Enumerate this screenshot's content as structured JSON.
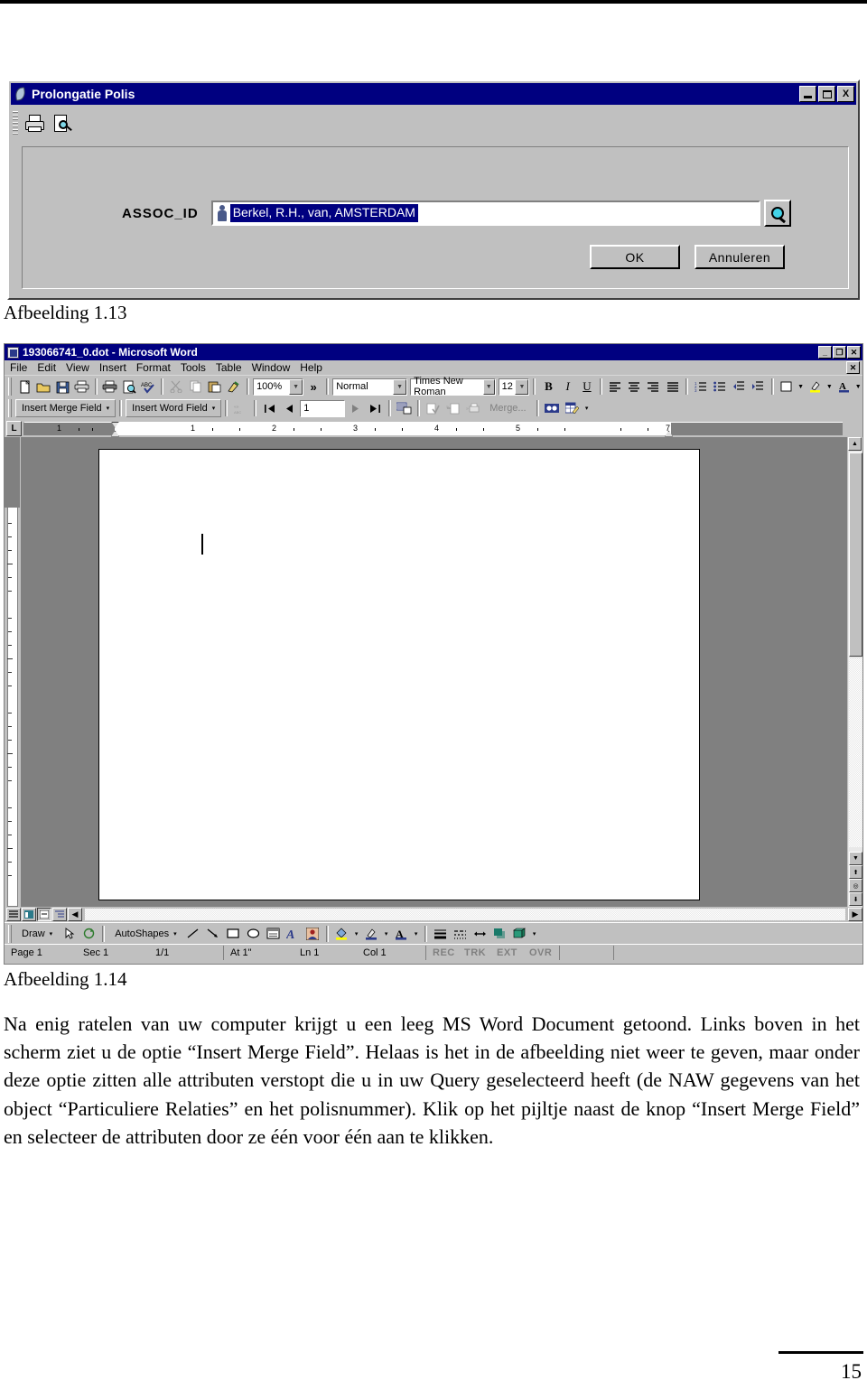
{
  "document": {
    "page_number": "15",
    "caption_113": "Afbeelding 1.13",
    "caption_114": "Afbeelding 1.14",
    "paragraph": "Na enig ratelen van uw computer krijgt u een leeg MS Word Document getoond. Links boven in het scherm ziet u de optie “Insert Merge Field”. Helaas is het in de afbeelding niet weer te geven, maar onder deze optie zitten alle attributen verstopt die u in uw Query geselecteerd heeft (de NAW gegevens van het object “Particuliere Relaties” en het polisnummer). Klik op het pijltje naast de knop “Insert Merge Field” en selecteer de attributen door ze één voor één aan te klikken."
  },
  "dialog": {
    "title": "Prolongatie Polis",
    "title_icon": "leaf-icon",
    "window_buttons": {
      "minimize": "_",
      "maximize": "□",
      "close": "X"
    },
    "toolbar": [
      {
        "name": "print-icon",
        "label": "Print"
      },
      {
        "name": "print-preview-icon",
        "label": "Print Preview"
      }
    ],
    "field": {
      "label": "ASSOC_ID",
      "value": "Berkel, R.H., van, AMSTERDAM",
      "placeholder": "",
      "record_icon": "person-icon",
      "find_button_icon": "magnifier-icon"
    },
    "buttons": {
      "ok": "OK",
      "cancel": "Annuleren"
    }
  },
  "word": {
    "title": "193066741_0.dot - Microsoft Word",
    "title_icon": "word-document-icon",
    "window_buttons": {
      "minimize": "_",
      "restore": "❐",
      "close": "✕"
    },
    "document_close": "✕",
    "menu": [
      "File",
      "Edit",
      "View",
      "Insert",
      "Format",
      "Tools",
      "Table",
      "Window",
      "Help"
    ],
    "standard_toolbar": {
      "icons": [
        "new-document-icon",
        "open-folder-icon",
        "save-icon",
        "print-icon",
        "print2-icon",
        "print-preview-icon",
        "spelling-check-icon",
        "cut-scissors-icon",
        "copy-icon",
        "paste-icon",
        "format-painter-icon"
      ],
      "zoom_value": "100%",
      "overflow_label": "»"
    },
    "formatting_toolbar": {
      "style_value": "Normal",
      "font_value": "Times New Roman",
      "size_value": "12",
      "bold": "B",
      "italic": "I",
      "underline": "U",
      "icons": [
        "align-left-icon",
        "align-center-icon",
        "align-right-icon",
        "align-justify-icon",
        "numbered-list-icon",
        "bulleted-list-icon",
        "decrease-indent-icon",
        "increase-indent-icon",
        "borders-icon",
        "highlight-icon",
        "font-color-icon"
      ]
    },
    "mailmerge_toolbar": {
      "insert_merge_field": "Insert Merge Field",
      "insert_word_field": "Insert Word Field",
      "view_merged_data_icon": "view-merged-data-icon",
      "nav_first": "⏮",
      "nav_prev": "◀",
      "record_number": "1",
      "nav_next": "▶",
      "nav_last": "⏭",
      "mail_merge_helper_icon": "mail-merge-helper-icon",
      "check_errors_icon": "check-errors-icon",
      "merge_to_new_doc_icon": "merge-to-new-document-icon",
      "merge_to_printer_icon": "merge-to-printer-icon",
      "merge_label": "Merge...",
      "find_record_icon": "find-record-icon",
      "edit_data_source_icon": "edit-data-source-icon",
      "dropdown": "▾"
    },
    "ruler": {
      "tab_selector": "L",
      "numbers": [
        "1",
        "1",
        "2",
        "3",
        "4",
        "5",
        "7"
      ]
    },
    "drawing_toolbar": {
      "draw_label": "Draw",
      "autoshapes_label": "AutoShapes",
      "icons": [
        "select-arrow-icon",
        "free-rotate-icon",
        "line-icon",
        "arrow-icon",
        "rectangle-icon",
        "oval-icon",
        "text-box-icon",
        "wordart-icon",
        "clip-art-icon",
        "fill-color-icon",
        "line-color-icon",
        "font-color-icon",
        "line-style-icon",
        "dash-style-icon",
        "arrow-style-icon",
        "shadow-icon",
        "3d-icon"
      ]
    },
    "status_bar": {
      "page": "Page 1",
      "section": "Sec 1",
      "pages": "1/1",
      "at": "At 1\"",
      "line": "Ln 1",
      "column": "Col 1",
      "rec": "REC",
      "trk": "TRK",
      "ext": "EXT",
      "ovr": "OVR"
    },
    "view_buttons": [
      "normal-view-icon",
      "web-layout-view-icon",
      "print-layout-view-icon",
      "outline-view-icon"
    ]
  },
  "colors": {
    "titlebar": "#000080",
    "chrome": "#c0c0c0",
    "selection": "#000080",
    "canvas": "#808080"
  }
}
